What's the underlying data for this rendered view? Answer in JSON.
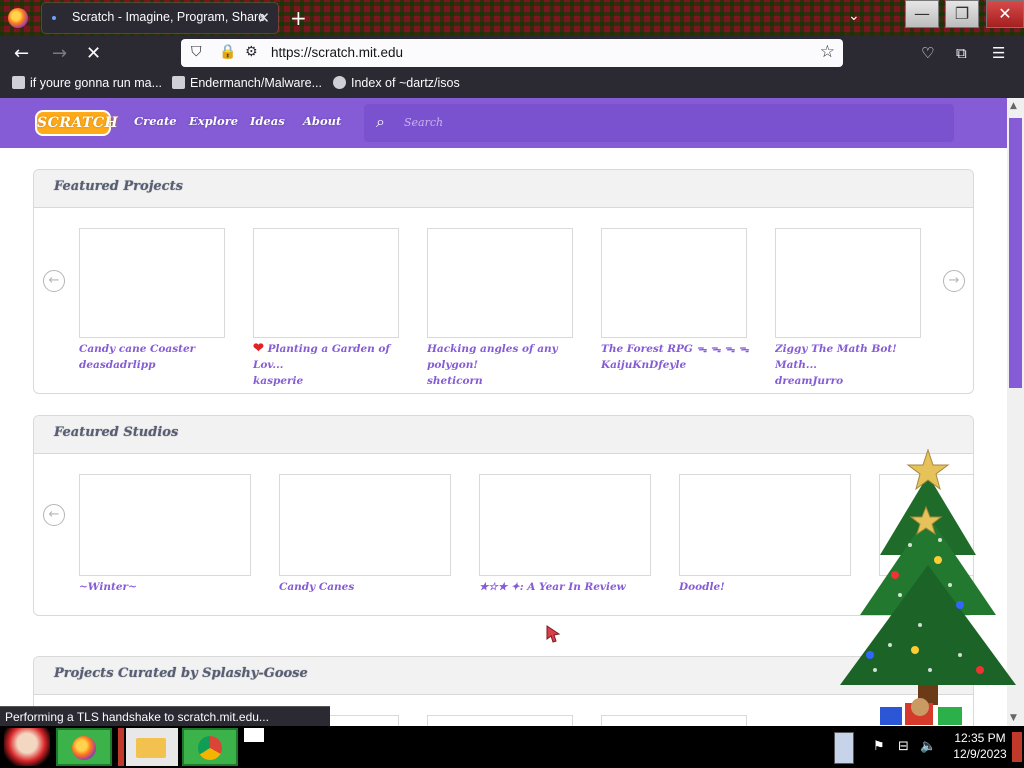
{
  "browser": {
    "tab_title": "Scratch - Imagine, Program, Share",
    "url": "https://scratch.mit.edu",
    "bookmarks": [
      {
        "label": "if youre gonna run ma..."
      },
      {
        "label": "Endermanch/Malware..."
      },
      {
        "label": "Index of ~dartz/isos"
      }
    ],
    "status_text": "Performing a TLS handshake to scratch.mit.edu..."
  },
  "scratch": {
    "logo_text": "SCRATCH",
    "menu": [
      "Create",
      "Explore",
      "Ideas",
      "About"
    ],
    "search_placeholder": "Search",
    "featured_projects": {
      "title": "Featured Projects",
      "items": [
        {
          "title": "Candy cane Coaster",
          "subtitle": "deasdadrlipp"
        },
        {
          "title": "Planting a Garden of Lov...",
          "subtitle": "kasperie"
        },
        {
          "title": "Hacking angles of any polygon!",
          "subtitle": "sheticorn"
        },
        {
          "title": "The Forest RPG ᯓ ᯓ ᯓ ᯓ",
          "subtitle": "KaijuKnDfeyle"
        },
        {
          "title": "Ziggy The Math Bot! Math...",
          "subtitle": "dreamJurro"
        }
      ]
    },
    "featured_studios": {
      "title": "Featured Studios",
      "items": [
        {
          "title": "~Winter~"
        },
        {
          "title": "Candy Canes"
        },
        {
          "title": "★☆★ ✦: A Year In Review"
        },
        {
          "title": "Doodle!"
        }
      ]
    },
    "curated": {
      "title": "Projects Curated by Splashy-Goose"
    }
  },
  "taskbar": {
    "time": "12:35 PM",
    "date": "12/9/2023"
  },
  "colors": {
    "scratch_purple": "#855cd6",
    "browser_dark": "#2b2a33"
  }
}
